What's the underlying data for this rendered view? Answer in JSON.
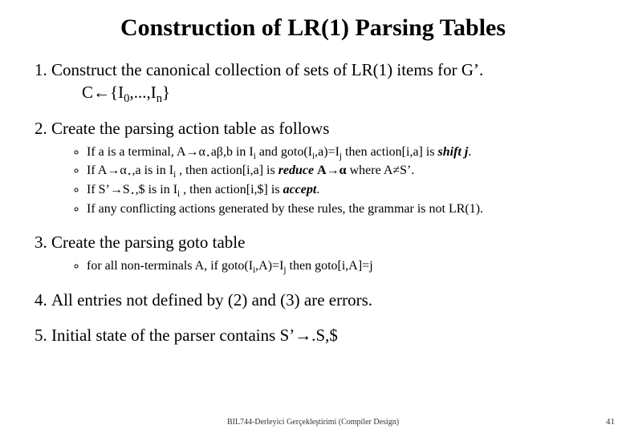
{
  "title": "Construction of LR(1) Parsing Tables",
  "items": [
    {
      "text": "Construct the canonical collection of sets of LR(1) items  for G’.",
      "indent_html": "C←{I<sub>0</sub>,...,I<sub>n</sub>}"
    },
    {
      "text": "Create the parsing action table as follows",
      "bullets_html": [
        "If  a is a terminal, A→α<span class=\"dot\">.</span>aβ,b in I<sub>i</sub> and goto(I<sub>i</sub>,a)=I<sub>j</sub> then action[i,a] is  <span class=\"bi\">shift j</span>.",
        "If  A→α<span class=\"dot\">.</span>,a  is in I<sub>i</sub> , then action[i,a] is <span class=\"bi\">reduce </span><span class=\"b\">A→α</span> where A≠S’.",
        "If  S’→S<span class=\"dot\">.</span>,$  is in I<sub>i</sub> , then action[i,$] is <span class=\"bi\">accept</span>.",
        "If any conflicting actions generated by these rules, the grammar is not LR(1)."
      ]
    },
    {
      "text": "Create the parsing goto table",
      "bullets_html": [
        "for all non-terminals A,  if goto(I<sub>i</sub>,A)=I<sub>j</sub>  then goto[i,A]=j"
      ]
    },
    {
      "text": "All entries not defined by (2) and (3) are errors."
    },
    {
      "text_html": "Initial state of the parser contains  S’→.S,$"
    }
  ],
  "footer": "BIL744-Derleyici Gerçekleştirimi (Compiler Design)",
  "page": "41"
}
